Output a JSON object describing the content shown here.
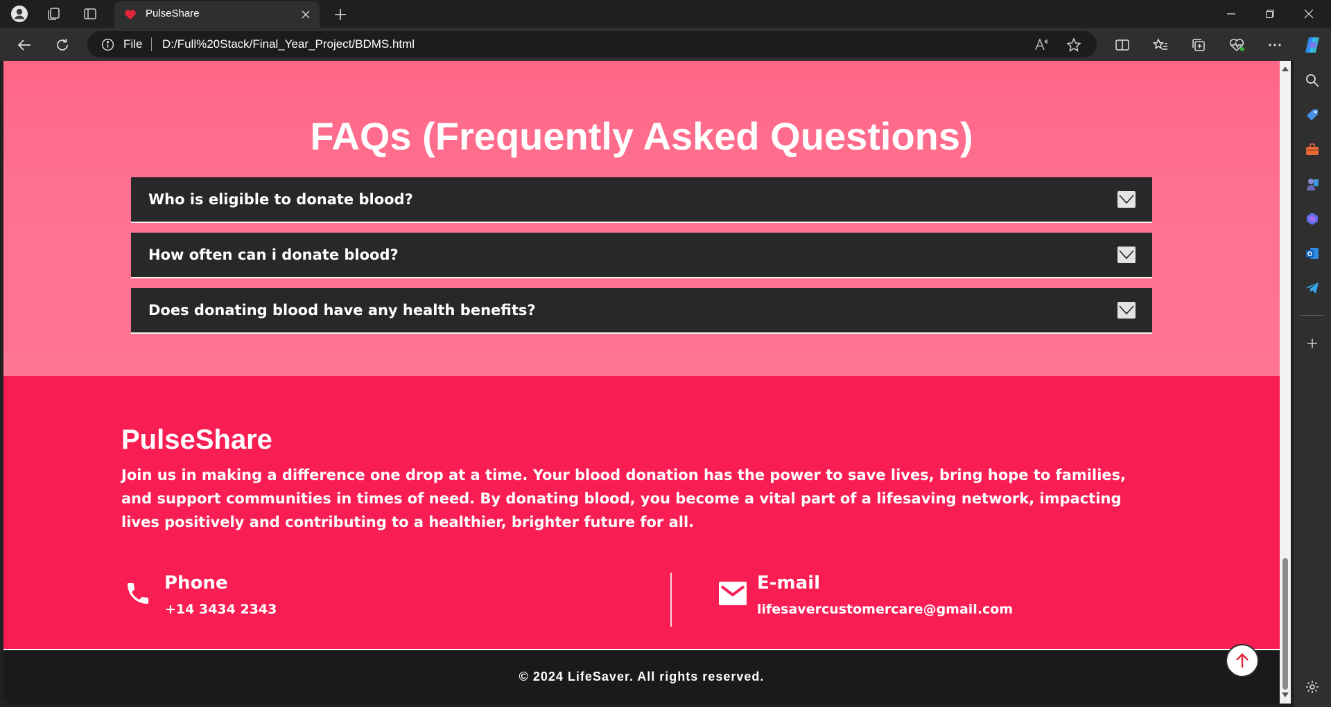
{
  "browser": {
    "tab_title": "PulseShare",
    "address_scheme": "File",
    "address_url": "D:/Full%20Stack/Final_Year_Project/BDMS.html",
    "icons": [
      "profile-icon",
      "workspaces-icon",
      "tab-actions-icon",
      "heart-favicon-icon",
      "close-icon",
      "plus-icon",
      "minimize-icon",
      "restore-icon",
      "close-window-icon",
      "back-icon",
      "refresh-icon",
      "info-icon",
      "read-aloud-icon",
      "favorite-star-icon",
      "split-screen-icon",
      "favorites-icon",
      "collections-icon",
      "browser-essentials-icon",
      "more-icon",
      "copilot-icon"
    ],
    "sidebar_icons": [
      "search-icon",
      "shopping-tag-icon",
      "tools-icon",
      "games-icon",
      "microsoft365-icon",
      "outlook-icon",
      "telegram-icon",
      "add-icon",
      "settings-icon"
    ]
  },
  "faq": {
    "title": "FAQs (Frequently Asked Questions)",
    "items": [
      {
        "question": "Who is eligible to donate blood?"
      },
      {
        "question": "How often can i donate blood?"
      },
      {
        "question": "Does donating blood have any health benefits?"
      }
    ]
  },
  "footer": {
    "brand": "PulseShare",
    "about": "Join us in making a difference one drop at a time. Your blood donation has the power to save lives, bring hope to families, and support communities in times of need. By donating blood, you become a vital part of a lifesaving network, impacting lives positively and contributing to a healthier, brighter future for all.",
    "phone": {
      "label": "Phone",
      "value": "+14 3434 2343"
    },
    "email": {
      "label": "E-mail",
      "value": "lifesavercustomercare@gmail.com"
    },
    "copyright": "© 2024 LifeSaver. All rights reserved."
  },
  "colors": {
    "faq_background": "#ff7191",
    "faq_item": "#282828",
    "footer_background": "#f81e54",
    "copyright_bar": "#1a1a1a"
  }
}
